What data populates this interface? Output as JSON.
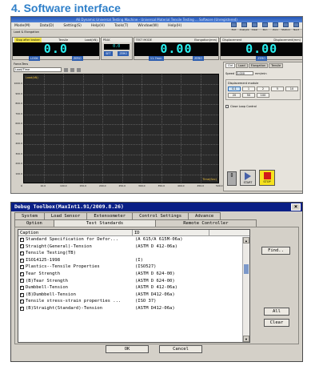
{
  "heading": "4. Software interface",
  "main_window": {
    "title": "Ali Dynamic Universal Testing Machine - Universal Material Tensile Testing ... Software (Unregistered)",
    "menu": [
      "Mode(M)",
      "Data(D)",
      "Setting(S)",
      "Help(H)",
      "Tools(T)",
      "Window(W)",
      "Help(H)"
    ],
    "toolbar": [
      {
        "label": "Exit",
        "icon": "exit-icon"
      },
      {
        "label": "Analyze",
        "icon": "analyze-icon"
      },
      {
        "label": "Clear",
        "icon": "clear-icon"
      },
      {
        "label": "Run",
        "icon": "run-icon"
      },
      {
        "label": "Zero",
        "icon": "zero-icon"
      },
      {
        "label": "Station",
        "icon": "station-icon"
      },
      {
        "label": "Next",
        "icon": "next-icon"
      }
    ],
    "strip": "Load & Elongation",
    "displays": [
      {
        "head_left": "Stop after broken",
        "head_mid": "Tensile",
        "head_right": "Load(kN)",
        "value": "0.0",
        "foot": [
          "LOOK",
          "ZERO"
        ]
      },
      {
        "head_left": "0.0",
        "head_mid": "",
        "head_right": "PEAK",
        "value": "0.0",
        "foot": [
          "SET",
          "ZERO"
        ]
      },
      {
        "head_left": "TEST MODE",
        "head_mid": "",
        "head_right": "Elongation(mm)",
        "value": "0.00",
        "foot": [
          "11.7mm",
          "ZERO"
        ]
      },
      {
        "head_left": "Displacement",
        "head_mid": "",
        "head_right": "Displacement(mm)",
        "value": "0.00",
        "foot": [
          "ZERO"
        ]
      }
    ],
    "graph": {
      "title": "Force-Tens",
      "select": "Load/Time",
      "corner_label": "Load(kN)",
      "force_label": "Time(Sec)",
      "y_ticks": [
        "1000.0",
        "900.0",
        "800.0",
        "700.0",
        "600.0",
        "500.0",
        "400.0",
        "300.0",
        "200.0",
        "100.0"
      ],
      "x_ticks": [
        "0",
        "10.0",
        "100.0",
        "150.0",
        "200.0",
        "250.0",
        "300.0",
        "350.0",
        "400.0",
        "450.0",
        "500.0"
      ]
    },
    "control": {
      "title": "Control Pad",
      "tabs": [
        "Ctrl",
        "Load",
        "Elongation",
        "Tensile"
      ],
      "speed_label": "Speed",
      "speed_value": "3.000",
      "speed_unit": "mm/min",
      "displacement_label": "Displacement module",
      "increments": [
        "0.1",
        "1",
        "2",
        "5",
        "10",
        "20",
        "50",
        "100"
      ],
      "close_loop": "Close Loop Control",
      "start": "START",
      "stop": "STOP"
    }
  },
  "dialog": {
    "title": "Debug Toolbox(MaxInt1.91/2009.8.26)",
    "close": "×",
    "tabs_top": [
      "System",
      "Load Sensor",
      "Extensometer",
      "Control Settings",
      "Advance"
    ],
    "tabs_bottom": [
      "Option",
      "Test Standards",
      "Remote Controller"
    ],
    "columns": [
      "Caption",
      "ID"
    ],
    "rows": [
      {
        "caption": "Standard Specification for Defor...",
        "id": "(A 615/A 615M-06a)",
        "checked": true
      },
      {
        "caption": "Straight(General)-Tension",
        "id": "(ASTM D 412-06a)",
        "checked": true
      },
      {
        "caption": "Tensile Testing(TB)",
        "id": "",
        "checked": true
      },
      {
        "caption": "ISO14125-1998",
        "id": "(I)",
        "checked": true
      },
      {
        "caption": "Plastics--Tensile Properties",
        "id": "(ISO527)",
        "checked": true
      },
      {
        "caption": "Tear Strength",
        "id": "(ASTM D 624-00)",
        "checked": true
      },
      {
        "caption": "(B)Tear Strength",
        "id": "(ASTM D 624-00)",
        "checked": true
      },
      {
        "caption": "Dumbbell-Tension",
        "id": "(ASTM D 412-06a)",
        "checked": true
      },
      {
        "caption": "(B)Dumbbell-Tension",
        "id": "(ASTM D412-06a)",
        "checked": true
      },
      {
        "caption": "Tensile stress-strain properties ...",
        "id": "(ISO 37)",
        "checked": true
      },
      {
        "caption": "(B)Straight(Standard)-Tension",
        "id": "(ASTM D412-06a)",
        "checked": true
      }
    ],
    "buttons": {
      "find": "Find..",
      "all": "All",
      "clear": "Clear",
      "ok": "OK",
      "cancel": "Cancel"
    }
  }
}
